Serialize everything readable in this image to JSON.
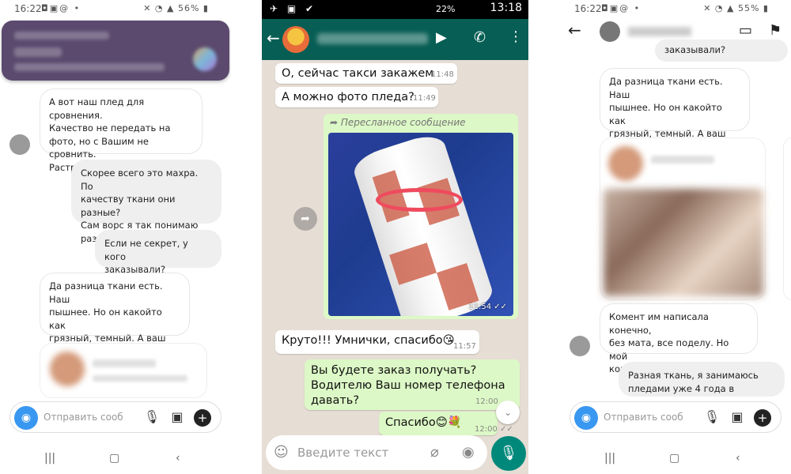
{
  "left": {
    "status": {
      "time": "16:22",
      "battery": "56%"
    },
    "messages": [
      {
        "text": "А вот наш плед для сровнения.\nКачество не передать на\nфото, но с Вашим не сровнить.\nРастроились.",
        "dir": "in"
      },
      {
        "text": "Скорее всего это махра. По\nкачеству ткани они разные?\nСам ворс я так понимаю\nразный",
        "dir": "out"
      },
      {
        "text": "Если не секрет, у кого\nзаказывали?",
        "dir": "out"
      },
      {
        "text": "Да разница ткани есть. Наш\nпышнее. Но он какойто как\nгрязный, темный. А ваш\nбеленький, мягкий.",
        "dir": "in"
      }
    ],
    "input_placeholder": "Отправить сообще..."
  },
  "middle": {
    "status": {
      "time": "13:18",
      "battery": "22%"
    },
    "messages": [
      {
        "text": "О, сейчас такси закажем",
        "time": "11:48",
        "dir": "in"
      },
      {
        "text": "А можно фото пледа?",
        "time": "11:49",
        "dir": "in"
      },
      {
        "forwarded_label": "Пересланное сообщение",
        "time": "11:54",
        "dir": "out"
      },
      {
        "text": "Круто!!! Умнички, спасибо😘",
        "time": "11:57",
        "dir": "in"
      },
      {
        "text": "Вы будете заказ получать?\nВодителю Ваш номер телефона\nдавать?",
        "time": "12:00",
        "dir": "out"
      },
      {
        "text": "Спасибо😊💐",
        "time": "12:00",
        "dir": "out"
      }
    ],
    "input_placeholder": "Введите текст"
  },
  "right": {
    "status": {
      "time": "16:22",
      "battery": "55%"
    },
    "messages": [
      {
        "text": "заказывали?",
        "dir": "out"
      },
      {
        "text": "Да разница ткани есть. Наш\nпышнее. Но он какойто как\nгрязный, темный. А ваш\nбеленький, мягкий.",
        "dir": "in"
      },
      {
        "text": "Комент им написала конечно,\nбез мата, все поделу. Но мой\nкомент быстро удалили.",
        "dir": "in"
      },
      {
        "text": "Разная ткань, я занимаюсь\nпледами уже 4 года в",
        "dir": "out"
      }
    ],
    "input_placeholder": "Отправить сообще..."
  },
  "colors": {
    "wa_header": "#075e54",
    "wa_out_bubble": "#dcf8c6",
    "ig_blue": "#3897f0",
    "wa_mic": "#00897b"
  }
}
